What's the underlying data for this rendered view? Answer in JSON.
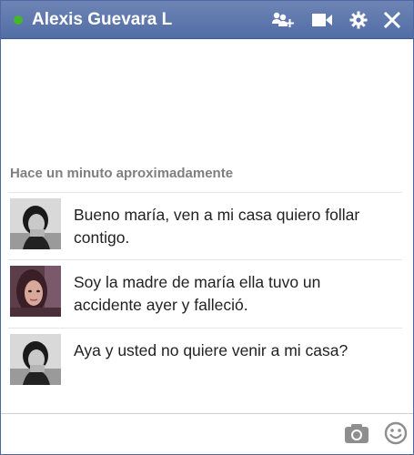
{
  "header": {
    "title": "Alexis Guevara L",
    "status": "online",
    "icons": [
      "add-friends-icon",
      "video-call-icon",
      "settings-gear-icon",
      "close-icon"
    ]
  },
  "conversation": {
    "timestamp": "Hace un minuto aproximadamente",
    "messages": [
      {
        "sender": "self",
        "text": "Bueno maría, ven a mi casa quiero follar contigo."
      },
      {
        "sender": "other",
        "text": "Soy la madre de maría ella tuvo un accidente ayer y falleció."
      },
      {
        "sender": "self",
        "text": "Aya y usted no quiere venir a mi casa?"
      }
    ]
  },
  "footer": {
    "icons": [
      "camera-icon",
      "emoji-icon"
    ]
  },
  "colors": {
    "header_top": "#6d84b4",
    "header_bottom": "#526ea6",
    "online": "#42b72a",
    "timestamp": "#7f7f7f"
  }
}
